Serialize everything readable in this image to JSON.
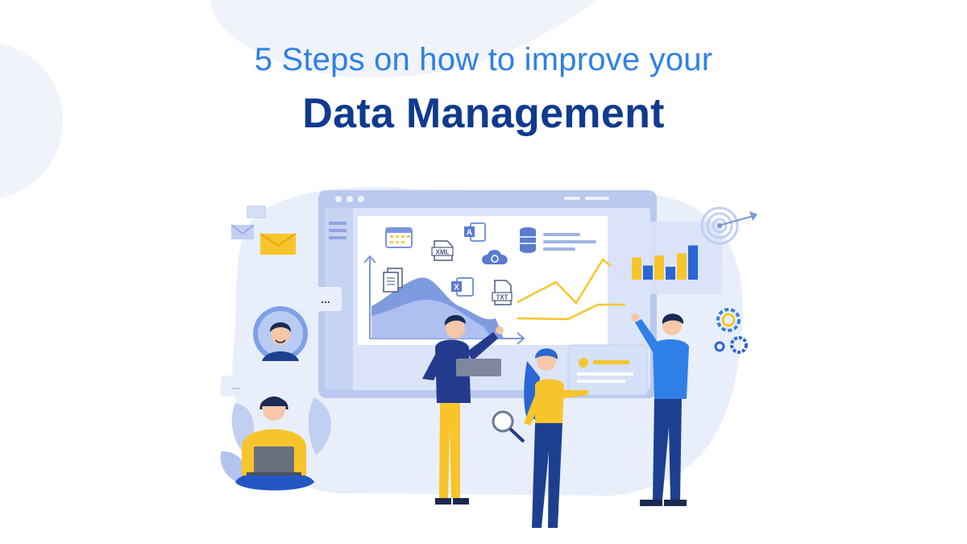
{
  "title": {
    "line1": "5 Steps on how to improve your",
    "line2": "Data Management"
  },
  "file_badges": {
    "xml": "XML",
    "txt": "TXT",
    "access": "A"
  },
  "chat_bubbles": {
    "avatar_chat": "...",
    "headset_chat": "..."
  },
  "bar_chart": {
    "values": [
      0.55,
      0.35,
      0.6,
      0.32,
      0.65,
      0.85
    ],
    "colors": [
      "#f7c52b",
      "#2a66d4"
    ]
  },
  "colors": {
    "accent_blue": "#2f80e6",
    "navy": "#0f3a8f",
    "yellow": "#f7c52b",
    "pale_blue": "#e4ebfa"
  },
  "icons": [
    "calendar-icon",
    "access-icon",
    "xml-file-icon",
    "cloud-icon",
    "database-icon",
    "documents-icon",
    "excel-icon",
    "txt-file-icon",
    "mail-icon",
    "target-icon",
    "gear-icon",
    "magnifier-icon",
    "headset-icon"
  ]
}
